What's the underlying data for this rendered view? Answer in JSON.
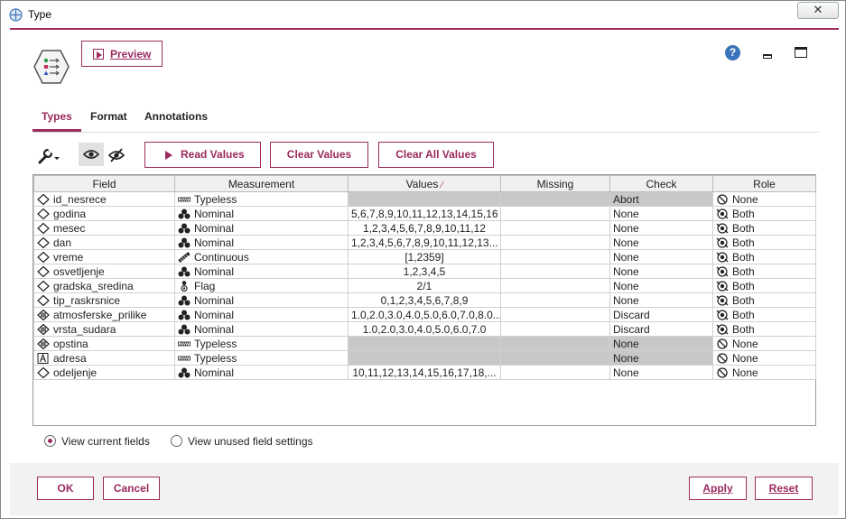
{
  "window": {
    "title": "Type",
    "close_label": "✕"
  },
  "header": {
    "preview_label": "Preview",
    "help_label": "?"
  },
  "tabs": [
    {
      "label": "Types",
      "active": true
    },
    {
      "label": "Format",
      "active": false
    },
    {
      "label": "Annotations",
      "active": false
    }
  ],
  "toolbar": {
    "read_values": "Read Values",
    "clear_values": "Clear Values",
    "clear_all_values": "Clear All Values"
  },
  "table": {
    "columns": [
      "Field",
      "Measurement",
      "Values",
      "Missing",
      "Check",
      "Role"
    ],
    "values_sort_marker": "⁄",
    "rows": [
      {
        "field": "id_nesrece",
        "field_icon": "diamond-icon",
        "measurement": "Typeless",
        "meas_icon": "typeless-icon",
        "values": "",
        "values_grey": true,
        "missing": "",
        "missing_grey": true,
        "check": "Abort",
        "check_grey": true,
        "role": "None",
        "role_icon": "none-icon"
      },
      {
        "field": "godina",
        "field_icon": "diamond-icon",
        "measurement": "Nominal",
        "meas_icon": "nominal-icon",
        "values": "5,6,7,8,9,10,11,12,13,14,15,16",
        "values_grey": false,
        "missing": "",
        "missing_grey": false,
        "check": "None",
        "check_grey": false,
        "role": "Both",
        "role_icon": "both-icon"
      },
      {
        "field": "mesec",
        "field_icon": "diamond-icon",
        "measurement": "Nominal",
        "meas_icon": "nominal-icon",
        "values": "1,2,3,4,5,6,7,8,9,10,11,12",
        "values_grey": false,
        "missing": "",
        "missing_grey": false,
        "check": "None",
        "check_grey": false,
        "role": "Both",
        "role_icon": "both-icon"
      },
      {
        "field": "dan",
        "field_icon": "diamond-icon",
        "measurement": "Nominal",
        "meas_icon": "nominal-icon",
        "values": "1,2,3,4,5,6,7,8,9,10,11,12,13...",
        "values_grey": false,
        "missing": "",
        "missing_grey": false,
        "check": "None",
        "check_grey": false,
        "role": "Both",
        "role_icon": "both-icon"
      },
      {
        "field": "vreme",
        "field_icon": "diamond-icon",
        "measurement": "Continuous",
        "meas_icon": "continuous-icon",
        "values": "[1,2359]",
        "values_grey": false,
        "missing": "",
        "missing_grey": false,
        "check": "None",
        "check_grey": false,
        "role": "Both",
        "role_icon": "both-icon"
      },
      {
        "field": "osvetljenje",
        "field_icon": "diamond-icon",
        "measurement": "Nominal",
        "meas_icon": "nominal-icon",
        "values": "1,2,3,4,5",
        "values_grey": false,
        "missing": "",
        "missing_grey": false,
        "check": "None",
        "check_grey": false,
        "role": "Both",
        "role_icon": "both-icon"
      },
      {
        "field": "gradska_sredina",
        "field_icon": "diamond-icon",
        "measurement": "Flag",
        "meas_icon": "flag-icon",
        "values": "2/1",
        "values_grey": false,
        "missing": "",
        "missing_grey": false,
        "check": "None",
        "check_grey": false,
        "role": "Both",
        "role_icon": "both-icon"
      },
      {
        "field": "tip_raskrsnice",
        "field_icon": "diamond-icon",
        "measurement": "Nominal",
        "meas_icon": "nominal-icon",
        "values": "0,1,2,3,4,5,6,7,8,9",
        "values_grey": false,
        "missing": "",
        "missing_grey": false,
        "check": "None",
        "check_grey": false,
        "role": "Both",
        "role_icon": "both-icon"
      },
      {
        "field": "atmosferske_prilike",
        "field_icon": "real-icon",
        "measurement": "Nominal",
        "meas_icon": "nominal-icon",
        "values": "1.0,2.0,3.0,4.0,5.0,6.0,7.0,8.0...",
        "values_grey": false,
        "missing": "",
        "missing_grey": false,
        "check": "Discard",
        "check_grey": false,
        "role": "Both",
        "role_icon": "both-icon"
      },
      {
        "field": "vrsta_sudara",
        "field_icon": "real-icon",
        "measurement": "Nominal",
        "meas_icon": "nominal-icon",
        "values": "1.0,2.0,3.0,4.0,5.0,6.0,7.0",
        "values_grey": false,
        "missing": "",
        "missing_grey": false,
        "check": "Discard",
        "check_grey": false,
        "role": "Both",
        "role_icon": "both-icon"
      },
      {
        "field": "opstina",
        "field_icon": "real-icon",
        "measurement": "Typeless",
        "meas_icon": "typeless-icon",
        "values": "",
        "values_grey": true,
        "missing": "",
        "missing_grey": true,
        "check": "None",
        "check_grey": true,
        "role": "None",
        "role_icon": "none-icon"
      },
      {
        "field": "adresa",
        "field_icon": "string-icon",
        "measurement": "Typeless",
        "meas_icon": "typeless-icon",
        "values": "",
        "values_grey": true,
        "missing": "",
        "missing_grey": true,
        "check": "None",
        "check_grey": true,
        "role": "None",
        "role_icon": "none-icon"
      },
      {
        "field": "odeljenje",
        "field_icon": "diamond-icon",
        "measurement": "Nominal",
        "meas_icon": "nominal-icon",
        "values": "10,11,12,13,14,15,16,17,18,...",
        "values_grey": false,
        "missing": "",
        "missing_grey": false,
        "check": "None",
        "check_grey": false,
        "role": "None",
        "role_icon": "none-icon"
      }
    ]
  },
  "view_options": [
    {
      "label": "View current fields",
      "selected": true
    },
    {
      "label": "View unused field settings",
      "selected": false
    }
  ],
  "footer": {
    "ok": "OK",
    "cancel": "Cancel",
    "apply": "Apply",
    "reset": "Reset"
  },
  "colors": {
    "accent": "#9b2a5e",
    "grey_cell": "#c8c8c8",
    "help": "#3b73b9"
  }
}
